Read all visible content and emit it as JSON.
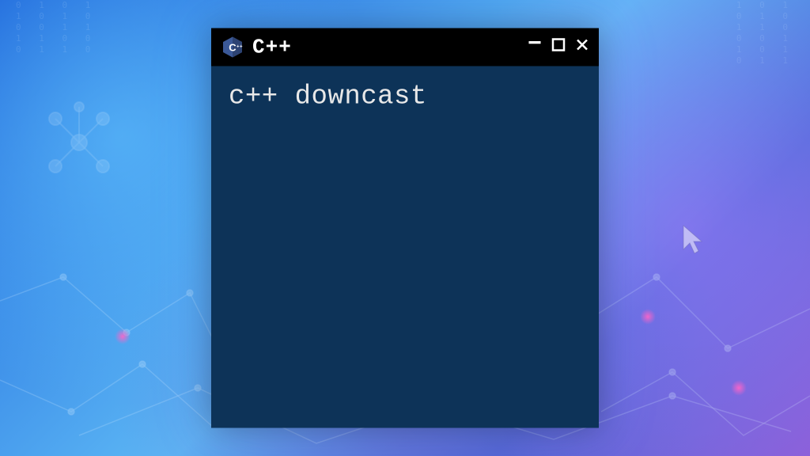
{
  "window": {
    "title": "C++",
    "icon_name": "cpp-logo"
  },
  "terminal": {
    "content": "c++ downcast"
  },
  "controls": {
    "minimize": "–",
    "maximize": "☐",
    "close": "✕"
  }
}
